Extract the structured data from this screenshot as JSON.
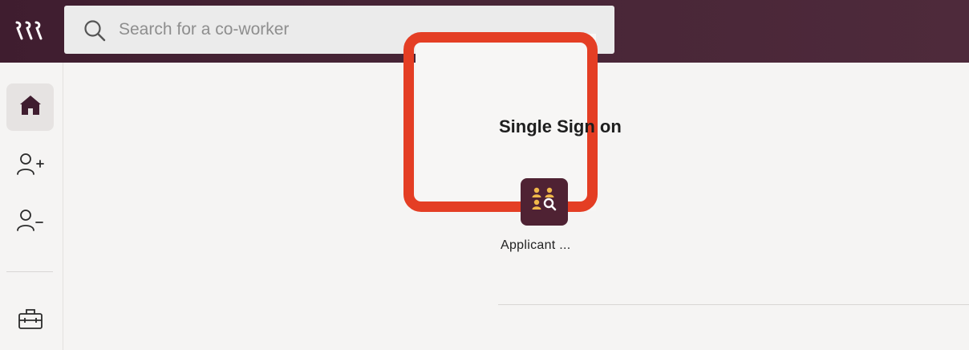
{
  "header": {
    "logo_icon": "workspace-logo-icon",
    "search": {
      "placeholder": "Search for a co-worker",
      "value": "",
      "icon": "search-icon"
    }
  },
  "sidebar": {
    "items": [
      {
        "id": "home",
        "icon": "home-icon",
        "active": true
      },
      {
        "id": "add-person",
        "icon": "person-add-icon",
        "active": false
      },
      {
        "id": "remove-person",
        "icon": "person-remove-icon",
        "active": false
      },
      {
        "id": "toolbox",
        "icon": "toolbox-icon",
        "active": false
      }
    ]
  },
  "main": {
    "section_title": "Single Sign on",
    "apps": [
      {
        "label": "Applicant ...",
        "icon": "applicant-search-icon"
      }
    ]
  },
  "colors": {
    "header_bg": "#4a2537",
    "accent": "#4f2233",
    "highlight": "#e43e24",
    "app_icon_gold": "#f0b84a"
  }
}
